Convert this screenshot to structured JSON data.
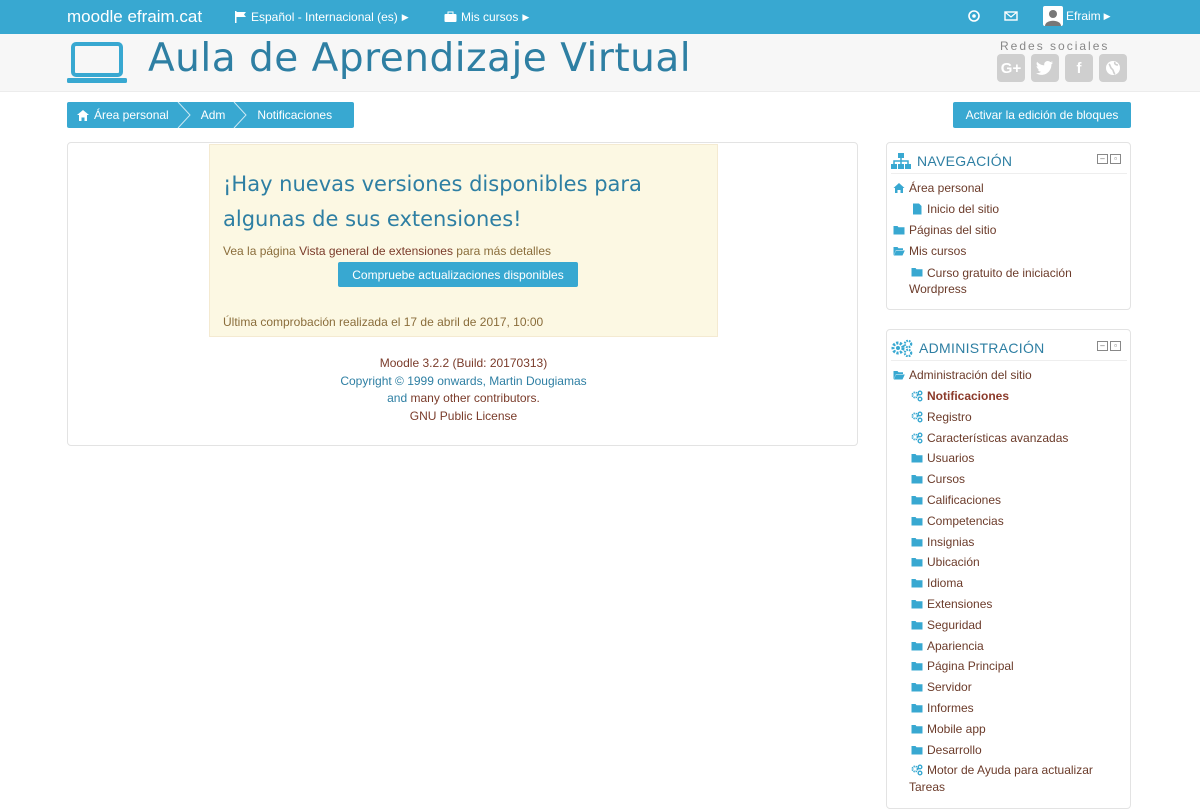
{
  "navbar": {
    "brand": "moodle efraim.cat",
    "language": "Español - Internacional (es)",
    "courses": "Mis cursos",
    "user": "Efraim"
  },
  "header": {
    "site_title": "Aula de Aprendizaje Virtual",
    "social_title": "Redes sociales",
    "social": [
      "G+",
      "twitter",
      "f",
      "globe"
    ]
  },
  "breadcrumb": [
    "Área personal",
    "Adm",
    "Notificaciones"
  ],
  "edit_blocks_label": "Activar la edición de bloques",
  "alert": {
    "heading": "¡Hay nuevas versiones disponibles para algunas de sus extensiones!",
    "text_before": "Vea la página ",
    "link": "Vista general de extensiones",
    "text_after": " para más detalles",
    "button": "Compruebe actualizaciones disponibles",
    "last_check": "Última comprobación realizada el 17 de abril de 2017, 10:00"
  },
  "footer": {
    "version": "Moodle 3.2.2 (Build: 20170313)",
    "copyright": "Copyright © 1999 onwards, Martin Dougiamas",
    "and": "and",
    "contributors": "many other contributors.",
    "license": "GNU Public License"
  },
  "nav_block": {
    "title": "NAVEGACIÓN",
    "items": [
      {
        "label": "Área personal",
        "icon": "home-icon"
      },
      {
        "label": "Inicio del sitio",
        "icon": "page-icon"
      },
      {
        "label": "Páginas del sitio",
        "icon": "folder-icon"
      },
      {
        "label": "Mis cursos",
        "icon": "folder-open-icon"
      },
      {
        "label": "Curso gratuito de iniciación",
        "label2": "Wordpress",
        "icon": "folder-icon"
      }
    ]
  },
  "admin_block": {
    "title": "ADMINISTRACIÓN",
    "root": "Administración del sitio",
    "items": [
      {
        "label": "Notificaciones",
        "icon": "gears-icon",
        "current": true
      },
      {
        "label": "Registro",
        "icon": "gears-icon"
      },
      {
        "label": "Características avanzadas",
        "icon": "gears-icon"
      },
      {
        "label": "Usuarios",
        "icon": "folder-icon"
      },
      {
        "label": "Cursos",
        "icon": "folder-icon"
      },
      {
        "label": "Calificaciones",
        "icon": "folder-icon"
      },
      {
        "label": "Competencias",
        "icon": "folder-icon"
      },
      {
        "label": "Insignias",
        "icon": "folder-icon"
      },
      {
        "label": "Ubicación",
        "icon": "folder-icon"
      },
      {
        "label": "Idioma",
        "icon": "folder-icon"
      },
      {
        "label": "Extensiones",
        "icon": "folder-icon"
      },
      {
        "label": "Seguridad",
        "icon": "folder-icon"
      },
      {
        "label": "Apariencia",
        "icon": "folder-icon"
      },
      {
        "label": "Página Principal",
        "icon": "folder-icon"
      },
      {
        "label": "Servidor",
        "icon": "folder-icon"
      },
      {
        "label": "Informes",
        "icon": "folder-icon"
      },
      {
        "label": "Mobile app",
        "icon": "folder-icon"
      },
      {
        "label": "Desarrollo",
        "icon": "folder-icon"
      },
      {
        "label": "Motor de Ayuda para actualizar",
        "label2": "Tareas",
        "icon": "gears-icon"
      }
    ]
  },
  "colors": {
    "accent": "#38a8d1",
    "title": "#2e7fa3",
    "alert_bg": "#fcf8e3",
    "link": "#7a3b2a"
  }
}
